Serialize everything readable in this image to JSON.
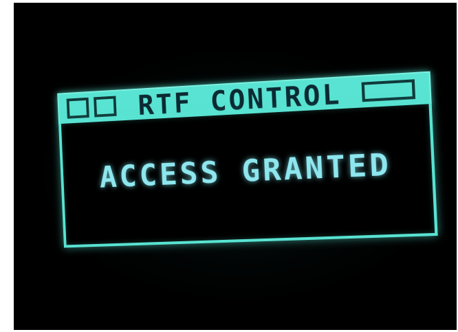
{
  "window": {
    "title": "RTF CONTROL",
    "message": "ACCESS GRANTED"
  },
  "titlebar_controls": {
    "left_boxes": [
      "square-box-icon",
      "square-box-icon"
    ],
    "right_box": "wide-box-icon"
  },
  "colors": {
    "accent": "#59e3d2",
    "text_dark": "#0c2a33",
    "message_text": "#8ee6ee",
    "background": "#000000"
  }
}
